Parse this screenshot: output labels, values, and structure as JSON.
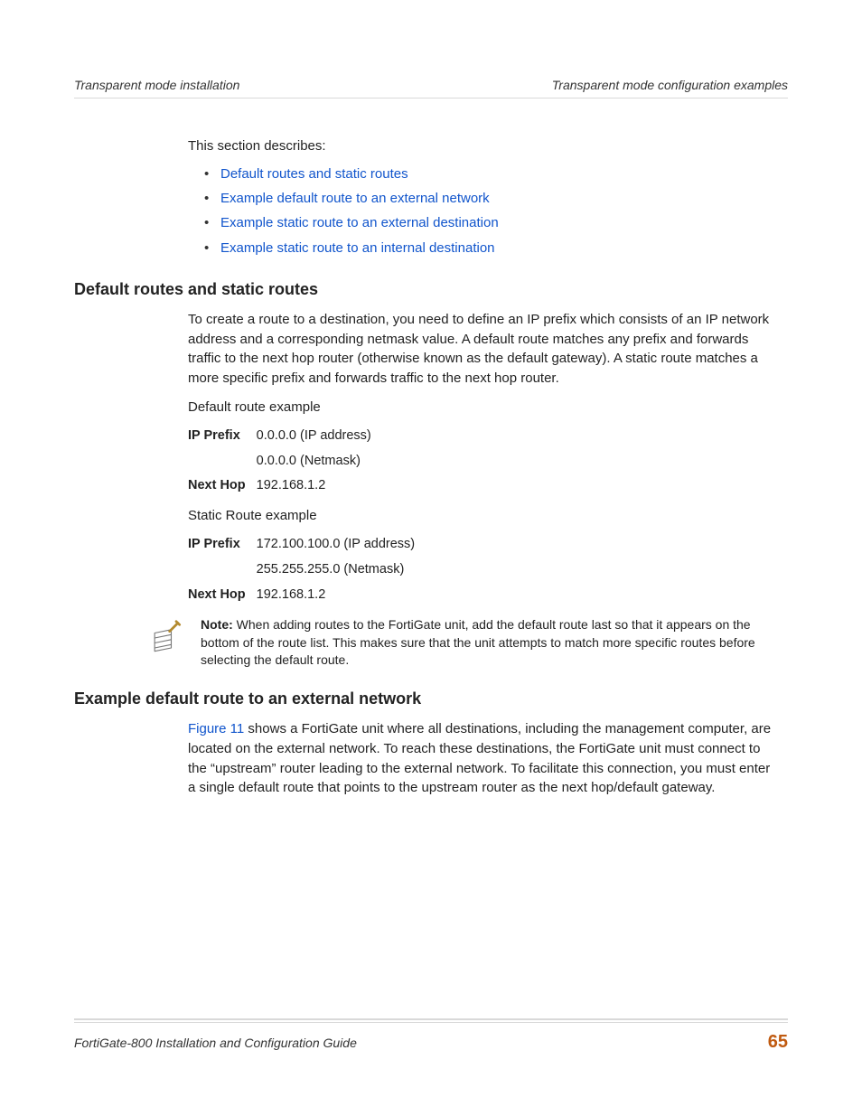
{
  "header": {
    "left": "Transparent mode installation",
    "right": "Transparent mode configuration examples"
  },
  "intro": "This section describes:",
  "toc": [
    "Default routes and static routes",
    "Example default route to an external network",
    "Example static route to an external destination",
    "Example static route to an internal destination"
  ],
  "section1": {
    "title": "Default routes and static routes",
    "para": "To create a route to a destination, you need to define an IP prefix which consists of an IP network address and a corresponding netmask value. A default route matches any prefix and forwards traffic to the next hop router (otherwise known as the default gateway). A static route matches a more specific prefix and forwards traffic to the next hop router.",
    "default_label": "Default route example",
    "default_table": {
      "ip_prefix_label": "IP Prefix",
      "ip_addr": "0.0.0.0 (IP address)",
      "netmask": "0.0.0.0 (Netmask)",
      "next_hop_label": "Next Hop",
      "next_hop": "192.168.1.2"
    },
    "static_label": "Static Route example",
    "static_table": {
      "ip_prefix_label": "IP Prefix",
      "ip_addr": "172.100.100.0 (IP address)",
      "netmask": "255.255.255.0 (Netmask)",
      "next_hop_label": "Next Hop",
      "next_hop": "192.168.1.2"
    }
  },
  "note": {
    "label": "Note:",
    "text": " When adding routes to the FortiGate unit, add the default route last so that it appears on the bottom of the route list. This makes sure that the unit attempts to match more specific routes before selecting the default route."
  },
  "section2": {
    "title": "Example default route to an external network",
    "figref": "Figure 11",
    "para_rest": " shows a FortiGate unit where all destinations, including the management computer, are located on the external network. To reach these destinations, the FortiGate unit must connect to the “upstream” router leading to the external network. To facilitate this connection, you must enter a single default route that points to the upstream router as the next hop/default gateway."
  },
  "footer": {
    "left": "FortiGate-800 Installation and Configuration Guide",
    "page": "65"
  }
}
